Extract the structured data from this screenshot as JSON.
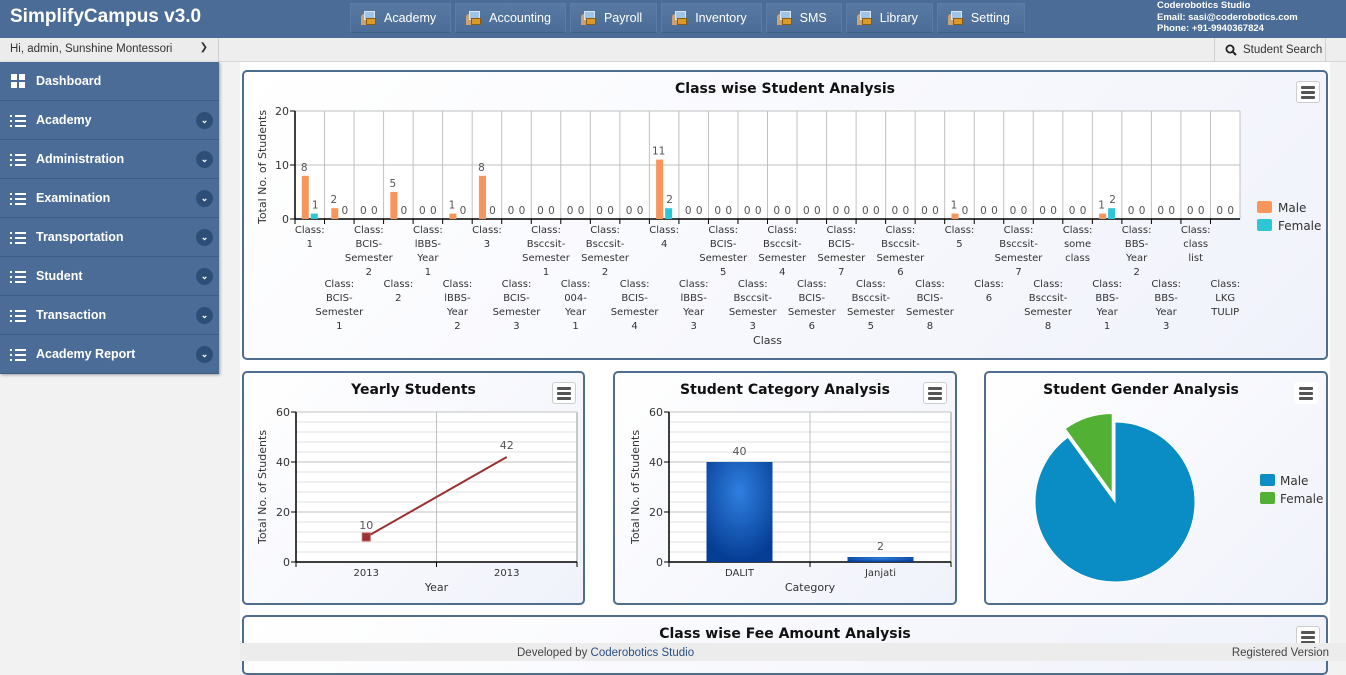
{
  "header": {
    "brand": "SimplifyCampus v3.0",
    "modules": [
      {
        "label": "Academy",
        "icon": "module-icon"
      },
      {
        "label": "Accounting",
        "icon": "module-icon"
      },
      {
        "label": "Payroll",
        "icon": "module-icon"
      },
      {
        "label": "Inventory",
        "icon": "module-icon"
      },
      {
        "label": "SMS",
        "icon": "module-icon"
      },
      {
        "label": "Library",
        "icon": "module-icon"
      },
      {
        "label": "Setting",
        "icon": "module-icon"
      }
    ],
    "company": {
      "name": "Coderobotics Studio",
      "email": "Email: sasi@coderobotics.com",
      "phone": "Phone: +91-9940367824"
    }
  },
  "subbar": {
    "user_greeting": "Hi, admin, Sunshine Montessori",
    "search_label": "Student Search"
  },
  "sidebar": {
    "items": [
      {
        "label": "Dashboard",
        "icon": "grid-icon",
        "expandable": false
      },
      {
        "label": "Academy",
        "icon": "list-icon",
        "expandable": true
      },
      {
        "label": "Administration",
        "icon": "list-icon",
        "expandable": true
      },
      {
        "label": "Examination",
        "icon": "list-icon",
        "expandable": true
      },
      {
        "label": "Transportation",
        "icon": "list-icon",
        "expandable": true
      },
      {
        "label": "Student",
        "icon": "list-icon",
        "expandable": true
      },
      {
        "label": "Transaction",
        "icon": "list-icon",
        "expandable": true
      },
      {
        "label": "Academy Report",
        "icon": "list-icon",
        "expandable": true
      }
    ]
  },
  "colors": {
    "header_bg": "#4a6c96",
    "male_bar": "#f7955a",
    "female_bar": "#2ec5d6",
    "line": "#9a3030",
    "category_bar": "#0f4aa5",
    "pie_male": "#0a8cc4",
    "pie_female": "#52b034"
  },
  "chart_data": [
    {
      "type": "bar",
      "title": "Class wise Student Analysis",
      "xlabel": "Class",
      "ylabel": "Total No. of Students",
      "ylim": [
        0,
        20
      ],
      "yticks": [
        0,
        10,
        20
      ],
      "legend": "right",
      "categories": [
        "Class: 1",
        "Class: BCIS-Semester 1",
        "Class: BCIS-Semester 2",
        "Class: 2",
        "Class: lBBS-Year 1",
        "Class: lBBS-Year 2",
        "Class: 3",
        "Class: BCIS-Semester 3",
        "Class: Bsccsit-Semester 1",
        "Class: 004-Year 1",
        "Class: Bsccsit-Semester 2",
        "Class: BCIS-Semester 4",
        "Class: 4",
        "Class: lBBS-Year 3",
        "Class: BCIS-Semester 5",
        "Class: Bsccsit-Semester 3",
        "Class: Bsccsit-Semester 4",
        "Class: BCIS-Semester 6",
        "Class: BCIS-Semester 7",
        "Class: Bsccsit-Semester 5",
        "Class: Bsccsit-Semester 6",
        "Class: BCIS-Semester 8",
        "Class: 5",
        "Class: 6",
        "Class: Bsccsit-Semester 7",
        "Class: Bsccsit-Semester 8",
        "Class: some class",
        "Class: BBS-Year 1",
        "Class: BBS-Year 2",
        "Class: BBS-Year 3",
        "Class: class list",
        "Class: LKG TULIP"
      ],
      "series": [
        {
          "name": "Male",
          "values": [
            8,
            2,
            0,
            5,
            0,
            1,
            8,
            0,
            0,
            0,
            0,
            0,
            11,
            0,
            0,
            0,
            0,
            0,
            0,
            0,
            0,
            0,
            1,
            0,
            0,
            0,
            0,
            1,
            0,
            0,
            0,
            0
          ]
        },
        {
          "name": "Female",
          "values": [
            1,
            0,
            0,
            0,
            0,
            0,
            0,
            0,
            0,
            0,
            0,
            0,
            2,
            0,
            0,
            0,
            0,
            0,
            0,
            0,
            0,
            0,
            0,
            0,
            0,
            0,
            0,
            2,
            0,
            0,
            0,
            0
          ]
        }
      ]
    },
    {
      "type": "line",
      "title": "Yearly Students",
      "xlabel": "Year",
      "ylabel": "Total No. of Students",
      "ylim": [
        0,
        60
      ],
      "yticks": [
        0,
        20,
        40,
        60
      ],
      "categories": [
        "2013",
        "2013"
      ],
      "values": [
        10,
        42
      ]
    },
    {
      "type": "bar",
      "title": "Student Category Analysis",
      "xlabel": "Category",
      "ylabel": "Total No. of Students",
      "ylim": [
        0,
        60
      ],
      "yticks": [
        0,
        20,
        40,
        60
      ],
      "categories": [
        "DALIT",
        "Janjati"
      ],
      "values": [
        40,
        2
      ]
    },
    {
      "type": "pie",
      "title": "Student Gender Analysis",
      "legend": "right",
      "labels": [
        "Male",
        "Female"
      ],
      "values": [
        36,
        4
      ]
    },
    {
      "type": "bar",
      "title": "Class wise Fee Amount Analysis"
    }
  ],
  "footer": {
    "developed_by": "Developed by ",
    "developer": "Coderobotics Studio",
    "version": "Registered Version"
  }
}
